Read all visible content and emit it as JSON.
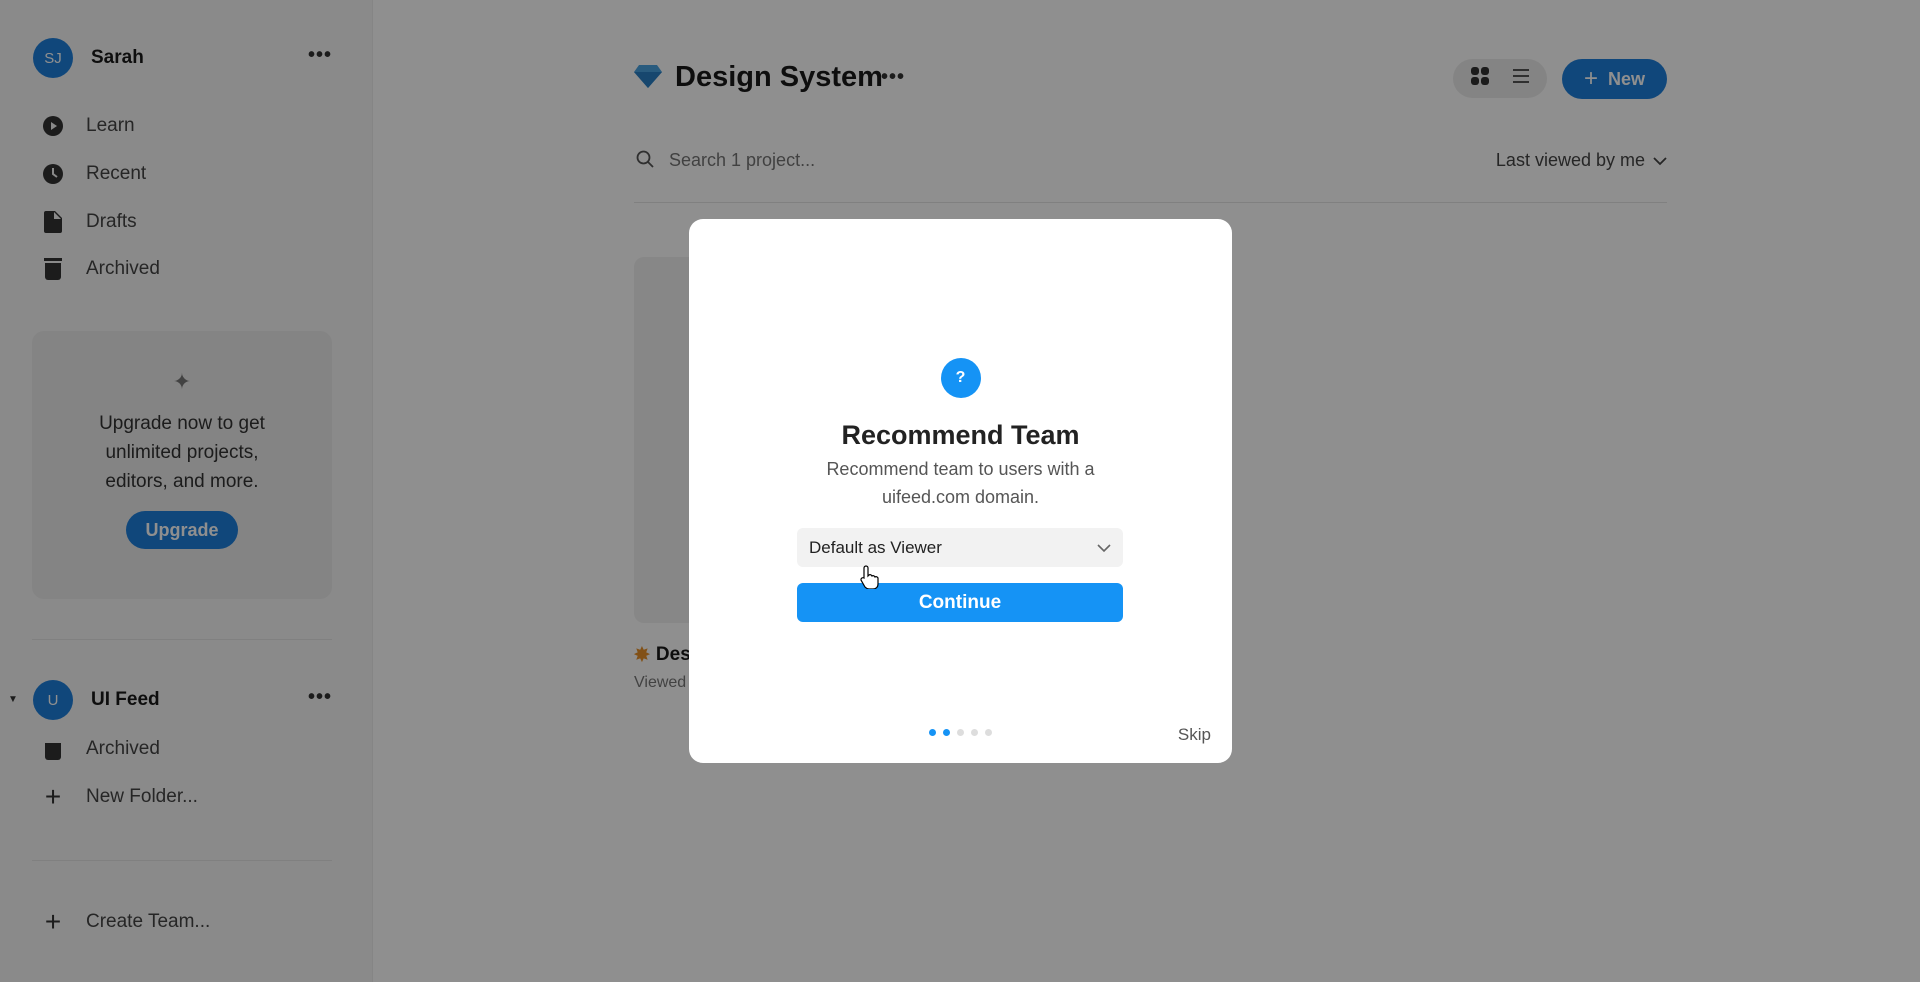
{
  "sidebar": {
    "user": {
      "initials": "SJ",
      "name": "Sarah"
    },
    "items": [
      {
        "label": "Learn",
        "icon": "play-circle-icon"
      },
      {
        "label": "Recent",
        "icon": "clock-icon"
      },
      {
        "label": "Drafts",
        "icon": "file-icon"
      },
      {
        "label": "Archived",
        "icon": "trash-icon"
      }
    ],
    "upgrade": {
      "text_lines": [
        "Upgrade now to get",
        "unlimited projects,",
        "editors, and more."
      ],
      "button": "Upgrade"
    },
    "team": {
      "initial": "U",
      "name": "UI Feed",
      "items": [
        {
          "label": "Archived"
        },
        {
          "label": "New Folder..."
        }
      ]
    },
    "create_team": "Create Team..."
  },
  "header": {
    "title": "Design System",
    "new_label": "New"
  },
  "search": {
    "placeholder": "Search 1 project..."
  },
  "sort": {
    "label": "Last viewed by me"
  },
  "project_card": {
    "title": "Des",
    "meta": "Viewed"
  },
  "modal": {
    "title": "Recommend Team",
    "subtitle_lines": [
      "Recommend team to users with a",
      "uifeed.com domain."
    ],
    "select_value": "Default as Viewer",
    "continue_label": "Continue",
    "skip_label": "Skip",
    "steps_total": 5,
    "current_step": 2
  },
  "colors": {
    "accent": "#1d7fdc",
    "modal_accent": "#1593f5"
  }
}
